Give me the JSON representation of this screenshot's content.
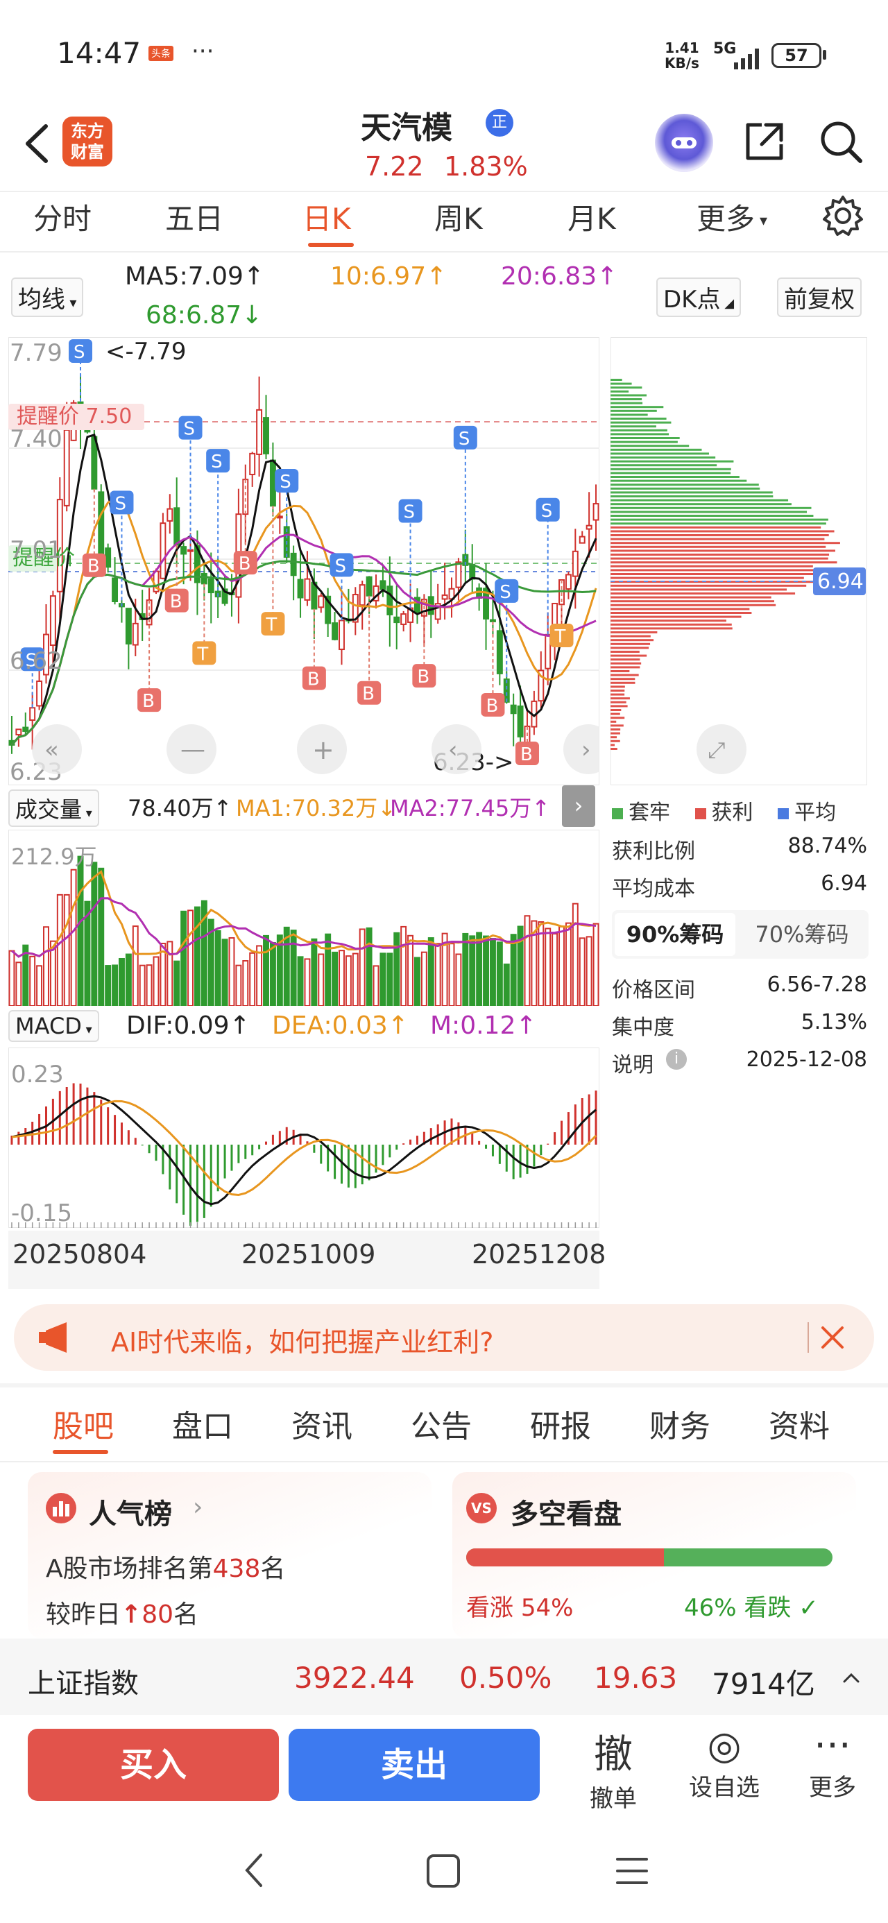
{
  "status_bar": {
    "time": "14:47",
    "net_speed": "1.41\nKB/s",
    "net_speed_top": "1.41",
    "net_speed_bottom": "KB/s",
    "network": "5G",
    "battery": "57",
    "app_badge": "头条"
  },
  "header": {
    "logo_line1": "东方",
    "logo_line2": "财富",
    "title": "天汽模",
    "badge": "正",
    "price": "7.22",
    "change_pct": "1.83%"
  },
  "period_tabs": [
    "分时",
    "五日",
    "日K",
    "周K",
    "月K",
    "更多"
  ],
  "ma_row": {
    "selector": "均线",
    "ma5": "MA5:7.09",
    "ma10": "10:6.97",
    "ma20": "20:6.83",
    "ma68": "68:6.87",
    "dk": "DK点",
    "fq": "前复权"
  },
  "kline": {
    "price_high": "7.79",
    "price_mid1": "7.40",
    "price_mid2": "7.01",
    "price_low_label": "6.62",
    "price_low": "6.23",
    "high_marker": "<-7.79",
    "low_marker": "6.23->",
    "alert1": "提醒价 7.50",
    "alert2": "提醒价"
  },
  "chips": {
    "current": "6.94",
    "legend": [
      "套牢",
      "获利",
      "平均"
    ],
    "rows": [
      {
        "label": "获利比例",
        "value": "88.74%"
      },
      {
        "label": "平均成本",
        "value": "6.94"
      }
    ],
    "tabs": [
      "90%筹码",
      "70%筹码"
    ],
    "rows2": [
      {
        "label": "价格区间",
        "value": "6.56-7.28"
      },
      {
        "label": "集中度",
        "value": "5.13%"
      },
      {
        "label": "说明",
        "value": "2025-12-08"
      }
    ]
  },
  "volume": {
    "selector": "成交量",
    "vol": "78.40万",
    "ma1": "MA1:70.32万",
    "ma2": "MA2:77.45万",
    "max": "212.9万"
  },
  "macd": {
    "selector": "MACD",
    "dif": "DIF:0.09",
    "dea": "DEA:0.03",
    "m": "M:0.12",
    "max": "0.23",
    "min": "-0.15"
  },
  "dates": [
    "20250804",
    "20251009",
    "20251208"
  ],
  "banner": {
    "text": "AI时代来临，如何把握产业红利?"
  },
  "guba_tabs": [
    "股吧",
    "盘口",
    "资讯",
    "公告",
    "研报",
    "财务",
    "资料"
  ],
  "popularity": {
    "title": "人气榜",
    "line1_prefix": "A股市场排名第",
    "rank": "438",
    "line1_suffix": "名",
    "line2_prefix": "较昨日",
    "change": "80",
    "line2_suffix": "名"
  },
  "bull_bear": {
    "title": "多空看盘",
    "up_label": "看涨",
    "up_pct": "54%",
    "down_pct": "46%",
    "down_label": "看跌",
    "up_fraction": 0.54
  },
  "index_bar": {
    "name": "上证指数",
    "value": "3922.44",
    "pct": "0.50%",
    "change": "19.63",
    "amount": "7914亿"
  },
  "trade": {
    "buy": "买入",
    "sell": "卖出",
    "tools": [
      {
        "icon": "撤",
        "label": "撤单"
      },
      {
        "icon": "◎",
        "label": "设自选"
      },
      {
        "icon": "···",
        "label": "更多"
      }
    ]
  },
  "chart_data": {
    "type": "candlestick",
    "ylim": [
      6.23,
      7.79
    ],
    "y_ticks": [
      7.79,
      7.4,
      7.01,
      6.62,
      6.23
    ],
    "x_tick_labels": [
      "20250804",
      "20251009",
      "20251208"
    ],
    "volume_max": "212.9万",
    "macd_range": [
      -0.15,
      0.23
    ]
  }
}
